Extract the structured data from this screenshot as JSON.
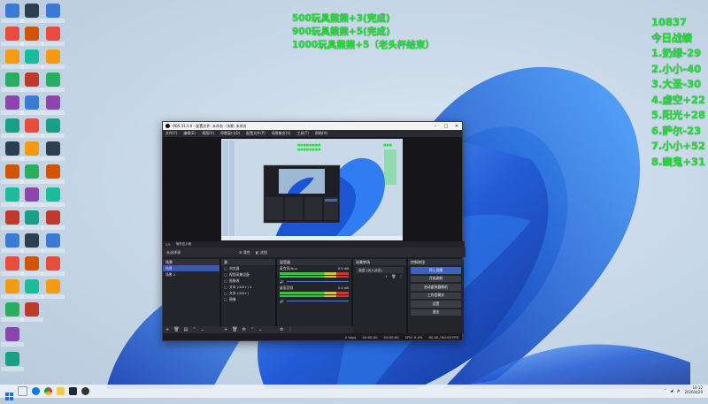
{
  "overlay_center": [
    "500玩具熊熊+3(完成)",
    "900玩具熊熊+5(完成)",
    "1000玩具熊熊+5（老头杯结束）"
  ],
  "overlay_right": {
    "count": "10837",
    "heading": "今日战绩",
    "entries": [
      "1.奶绿-29",
      "2.小小-40",
      "3.大圣-30",
      "4.虚空+22",
      "5.阳光+28",
      "6.萨尔-23",
      "7.小小+52",
      "8.幽鬼+31"
    ]
  },
  "obs": {
    "title": "OBS 31.0.0 - 配置文件: 未命名 - 场景: 未命名",
    "window_controls": [
      "–",
      "□",
      "✕"
    ],
    "menu": [
      "文件(F)",
      "编辑(E)",
      "视图(V)",
      "停靠窗口(D)",
      "配置文件(P)",
      "场景集合(S)",
      "工具(T)",
      "帮助(H)"
    ],
    "preview_bar": [
      "2/5",
      "捕获显示器"
    ],
    "context_bar": [
      "未选择源",
      "属性",
      "滤镜"
    ],
    "scenes": {
      "header": "场景",
      "items": [
        "场景",
        "场景 2"
      ]
    },
    "sources": {
      "header": "源",
      "items": [
        "浏览器",
        "视频采集设备",
        "图像源",
        "文本 (GDI+) 2",
        "文本 (GDI+)",
        "图像"
      ]
    },
    "mixer": {
      "header": "混音器",
      "tracks": [
        {
          "name": "麦克风/Aux",
          "db": "0.0 dB"
        },
        {
          "name": "桌面音频",
          "db": "0.0 dB"
        }
      ]
    },
    "transitions": {
      "header": "场景转场",
      "value": "渐变 (淡入淡出)"
    },
    "controls": {
      "header": "控制按钮",
      "buttons": [
        "停止直播",
        "开始录制",
        "启动虚拟摄像机",
        "工作室模式",
        "设置",
        "退出"
      ]
    },
    "status": [
      "0 kbps",
      "00:00:00",
      "00:00:00",
      "CPU: 0.4%",
      "60.00 / 60.00 FPS"
    ]
  },
  "taskbar": {
    "time": "10:12",
    "date": "2026/4/29"
  },
  "colors": {
    "overlay_green": "#25e03a",
    "obs_accent": "#3f63b8",
    "obs_bg": "#1e1e24"
  }
}
